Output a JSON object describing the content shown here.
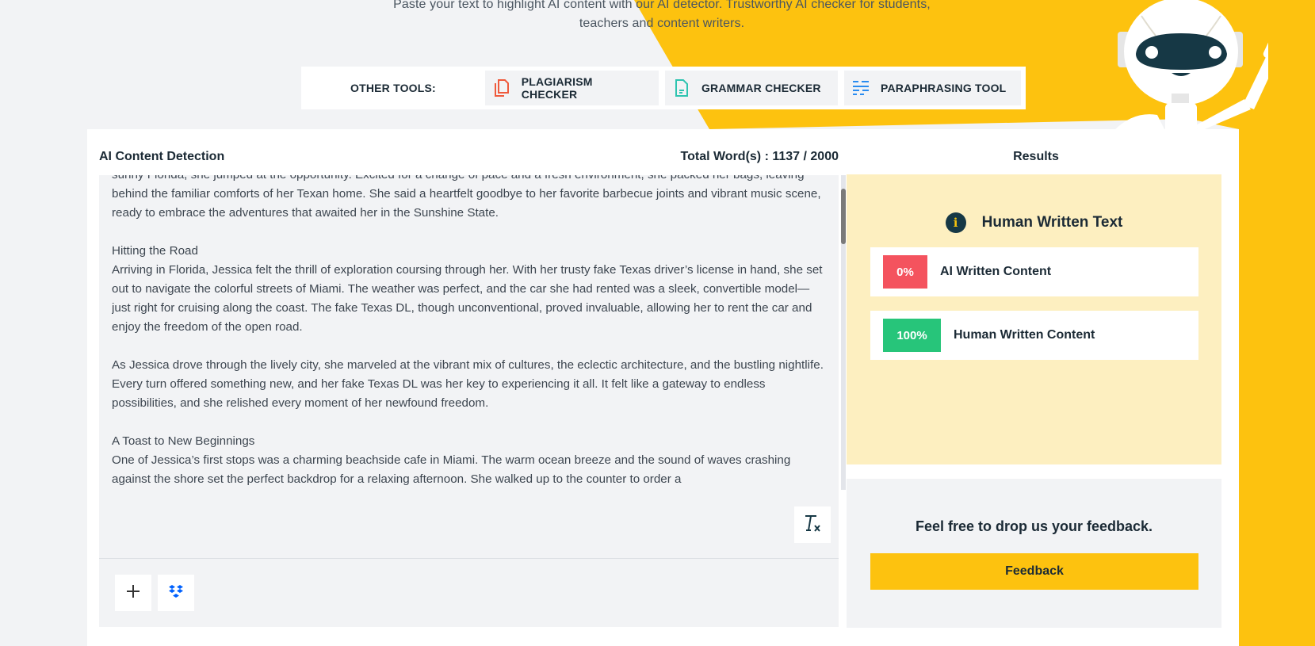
{
  "header": {
    "subtitle_line1": "Paste your text to highlight AI content with our AI detector. Trustworthy AI checker for students,",
    "subtitle_line2": "teachers and content writers."
  },
  "other_tools": {
    "label": "OTHER TOOLS:",
    "items": [
      {
        "label": "PLAGIARISM CHECKER",
        "icon": "copy-documents-icon",
        "color": "#ef5a3c"
      },
      {
        "label": "GRAMMAR CHECKER",
        "icon": "document-icon",
        "color": "#2ec4b0"
      },
      {
        "label": "PARAPHRASING TOOL",
        "icon": "text-lines-icon",
        "color": "#2a8cf0"
      }
    ]
  },
  "detector": {
    "title": "AI Content Detection",
    "word_count_label": "Total Word(s) : 1137 / 2000",
    "paragraphs": [
      "sunny Florida, she jumped at the opportunity. Excited for a change of pace and a fresh environment, she packed her bags, leaving behind the familiar comforts of her Texan home. She said a heartfelt goodbye to her favorite barbecue joints and vibrant music scene, ready to embrace the adventures that awaited her in the Sunshine State.",
      "Hitting the Road\nArriving in Florida, Jessica felt the thrill of exploration coursing through her. With her trusty fake Texas driver’s license in hand, she set out to navigate the colorful streets of Miami. The weather was perfect, and the car she had rented was a sleek, convertible model—just right for cruising along the coast. The fake Texas DL, though unconventional, proved invaluable, allowing her to rent the car and enjoy the freedom of the open road.",
      "As Jessica drove through the lively city, she marveled at the vibrant mix of cultures, the eclectic architecture, and the bustling nightlife. Every turn offered something new, and her fake Texas DL was her key to experiencing it all. It felt like a gateway to endless possibilities, and she relished every moment of her newfound freedom.",
      "A Toast to New Beginnings\nOne of Jessica’s first stops was a charming beachside cafe in Miami. The warm ocean breeze and the sound of waves crashing against the shore set the perfect backdrop for a relaxing afternoon. She walked up to the counter to order a"
    ],
    "clear_format_icon": "clear-formatting-icon",
    "upload_icon": "plus-icon",
    "dropbox_icon": "dropbox-icon"
  },
  "results": {
    "title": "Results",
    "verdict": "Human Written Text",
    "ai": {
      "percent": "0%",
      "label": "AI Written Content",
      "color": "#f4535e"
    },
    "human": {
      "percent": "100%",
      "label": "Human Written Content",
      "color": "#27c57a"
    }
  },
  "feedback": {
    "prompt": "Feel free to drop us your feedback.",
    "button_label": "Feedback"
  },
  "colors": {
    "brand_yellow": "#fdc20f",
    "panel_yellow": "#fdefc0",
    "dark_navy": "#163845"
  }
}
